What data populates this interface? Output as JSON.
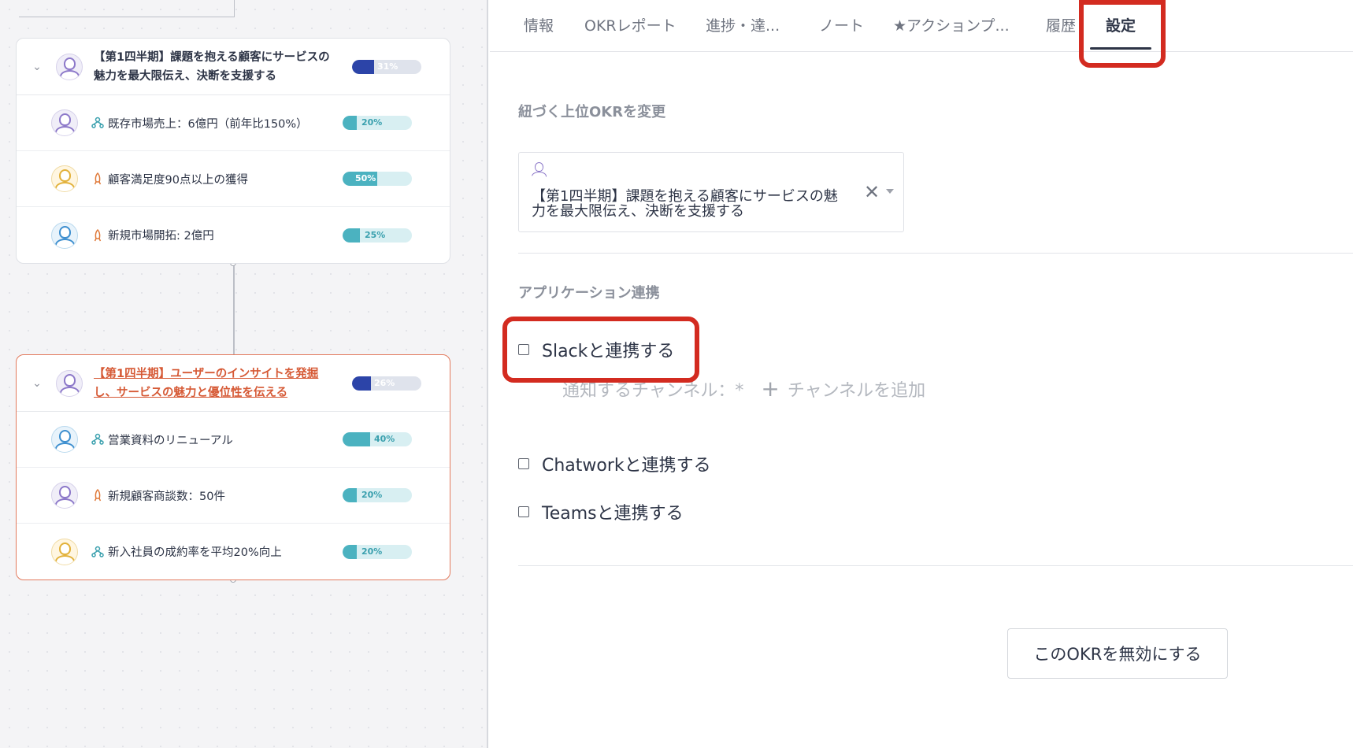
{
  "okr_tree": {
    "cards": [
      {
        "objective": {
          "title": "【第1四半期】課題を抱える顧客にサービスの魅力を最大限伝え、決断を支援する",
          "progress": 31,
          "progress_label": "31%",
          "avatar": "purple-avatar",
          "linked": false
        },
        "key_results": [
          {
            "text": "既存市場売上：6億円（前年比150%）",
            "progress": 20,
            "progress_label": "20%",
            "icon": "network-icon",
            "avatar": "purple-avatar"
          },
          {
            "text": "顧客満足度90点以上の獲得",
            "progress": 50,
            "progress_label": "50%",
            "icon": "rocket-icon",
            "avatar": "yellow-avatar"
          },
          {
            "text": "新規市場開拓: 2億円",
            "progress": 25,
            "progress_label": "25%",
            "icon": "rocket-icon",
            "avatar": "blue-avatar"
          }
        ]
      },
      {
        "objective": {
          "title": "【第1四半期】ユーザーのインサイトを発掘し、サービスの魅力と優位性を伝える",
          "progress": 26,
          "progress_label": "26%",
          "avatar": "purple-avatar",
          "linked": true
        },
        "key_results": [
          {
            "text": "営業資料のリニューアル",
            "progress": 40,
            "progress_label": "40%",
            "icon": "network-icon",
            "avatar": "blue-avatar"
          },
          {
            "text": "新規顧客商談数：50件",
            "progress": 20,
            "progress_label": "20%",
            "icon": "rocket-icon",
            "avatar": "purple-avatar"
          },
          {
            "text": "新入社員の成約率を平均20%向上",
            "progress": 20,
            "progress_label": "20%",
            "icon": "network-icon",
            "avatar": "yellow-avatar"
          }
        ]
      }
    ]
  },
  "tabs": [
    {
      "label": "情報"
    },
    {
      "label": "OKRレポート"
    },
    {
      "label": "進捗・達..."
    },
    {
      "label": "ノート"
    },
    {
      "label": "★アクションプ..."
    },
    {
      "label": "履歴"
    },
    {
      "label": "設定",
      "active": true
    }
  ],
  "settings": {
    "parent_okr_label": "紐づく上位OKRを変更",
    "parent_okr_value": "【第1四半期】課題を抱える顧客にサービスの魅力を最大限伝え、決断を支援する",
    "clear_icon": "close-icon",
    "app_integration_label": "アプリケーション連携",
    "integrations": [
      {
        "label": "Slackと連携する",
        "checked": false
      },
      {
        "label": "Chatworkと連携する",
        "checked": false
      },
      {
        "label": "Teamsと連携する",
        "checked": false
      }
    ],
    "channel_label": "通知するチャンネル：*",
    "add_channel_label": "チャンネルを追加",
    "disable_button_label": "このOKRを無効にする"
  },
  "colors": {
    "objective_bar": "#2c44a8",
    "kr_bar": "#4bb2c0",
    "highlight": "#d32b20",
    "linked_title": "#d65a36"
  }
}
